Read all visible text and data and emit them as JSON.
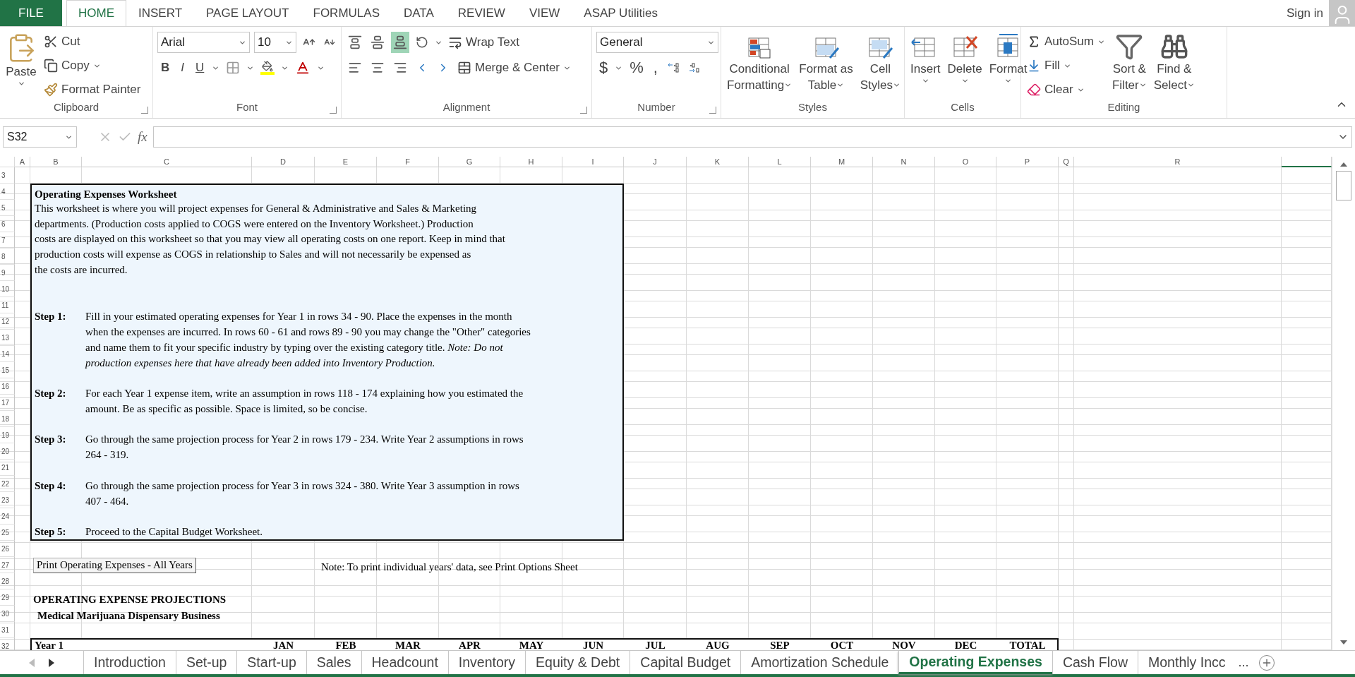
{
  "menu_tabs": [
    {
      "label": "FILE",
      "kind": "file",
      "selected": false
    },
    {
      "label": "HOME",
      "kind": "tab",
      "selected": true
    },
    {
      "label": "INSERT",
      "kind": "tab",
      "selected": false
    },
    {
      "label": "PAGE LAYOUT",
      "kind": "tab",
      "selected": false
    },
    {
      "label": "FORMULAS",
      "kind": "tab",
      "selected": false
    },
    {
      "label": "DATA",
      "kind": "tab",
      "selected": false
    },
    {
      "label": "REVIEW",
      "kind": "tab",
      "selected": false
    },
    {
      "label": "VIEW",
      "kind": "tab",
      "selected": false
    },
    {
      "label": "ASAP Utilities",
      "kind": "tab",
      "selected": false
    }
  ],
  "account": {
    "label": "Sign in"
  },
  "ribbon": {
    "groups": [
      {
        "kind": "clipboard",
        "label": "Clipboard",
        "launcher": true,
        "paste": "Paste",
        "items": [
          "Cut",
          "Copy",
          "Format Painter"
        ]
      },
      {
        "kind": "font",
        "label": "Font",
        "launcher": true,
        "font": "Arial",
        "size": "10",
        "styles": [
          "B",
          "I",
          "U"
        ]
      },
      {
        "kind": "alignment",
        "label": "Alignment",
        "launcher": true,
        "vertical_align": [
          {
            "selected": false
          },
          {
            "selected": false
          },
          {
            "selected": true
          }
        ],
        "wrap": "Wrap Text",
        "merge": "Merge & Center"
      },
      {
        "kind": "number",
        "label": "Number",
        "launcher": true,
        "format": "General",
        "symbols": [
          "$",
          "%",
          ","
        ]
      },
      {
        "kind": "styles",
        "label": "Styles",
        "buttons": [
          {
            "lines": [
              "Conditional",
              "Formatting"
            ]
          },
          {
            "lines": [
              "Format as",
              "Table"
            ]
          },
          {
            "lines": [
              "Cell",
              "Styles"
            ]
          }
        ]
      },
      {
        "kind": "cells",
        "label": "Cells",
        "buttons": [
          "Insert",
          "Delete",
          "Format"
        ]
      },
      {
        "kind": "editing",
        "label": "Editing",
        "small": [
          "AutoSum",
          "Fill",
          "Clear"
        ],
        "buttons": [
          {
            "lines": [
              "Sort &",
              "Filter"
            ]
          },
          {
            "lines": [
              "Find &",
              "Select"
            ]
          }
        ]
      }
    ]
  },
  "formula_bar": {
    "name_box": "S32",
    "fx": "fx"
  },
  "columns": [
    "A",
    "B",
    "C",
    "D",
    "E",
    "F",
    "G",
    "H",
    "I",
    "J",
    "K",
    "L",
    "M",
    "N",
    "O",
    "P",
    "Q",
    "R"
  ],
  "rows": [
    "3",
    "4",
    "5",
    "6",
    "7",
    "8",
    "9",
    "10",
    "11",
    "12",
    "13",
    "14",
    "15",
    "16",
    "17",
    "18",
    "19",
    "20",
    "21",
    "22",
    "23",
    "24",
    "25",
    "26",
    "27",
    "28",
    "29",
    "30",
    "31",
    "32"
  ],
  "instructions": {
    "title": "Operating Expenses Worksheet",
    "paragraph": [
      "This worksheet is where you will project expenses for General & Administrative and Sales & Marketing",
      "departments.  (Production costs applied to COGS were entered on the Inventory Worksheet.)  Production",
      "costs are displayed on this worksheet so that you may view all operating costs on one report.  Keep in mind that",
      "production costs will expense as COGS in relationship to Sales and will not necessarily be expensed as",
      "the costs are incurred."
    ],
    "steps": [
      {
        "label": "Step 1:",
        "lines": [
          "Fill in your estimated operating expenses for Year 1 in rows 34 - 90. Place the expenses in the month",
          "when the expenses are incurred. In rows 60 - 61 and rows 89 - 90 you may change the \"Other\" categories",
          "and name them to fit your specific industry by typing over the existing category title. *Note:  Do not*",
          "*production expenses here that have already been added into Inventory Production.*"
        ]
      },
      {
        "label": "Step 2:",
        "lines": [
          "For each Year 1 expense item, write an assumption in rows 118 - 174 explaining how you estimated the",
          "amount. Be as specific as possible. Space is limited, so be concise."
        ]
      },
      {
        "label": "Step 3:",
        "lines": [
          "Go through the same projection process for Year 2 in rows 179 - 234. Write Year 2 assumptions in rows",
          "264 - 319."
        ]
      },
      {
        "label": "Step 4:",
        "lines": [
          "Go through the same projection process for Year 3 in rows 324 - 380. Write Year 3 assumption in rows",
          "407 - 464."
        ]
      },
      {
        "label": "Step 5:",
        "lines": [
          "Proceed to the Capital Budget Worksheet."
        ]
      }
    ]
  },
  "print_button": "Print Operating Expenses - All Years",
  "print_note": "Note:  To print individual years' data, see Print Options Sheet",
  "projection_title": "OPERATING EXPENSE PROJECTIONS",
  "business_name": "Medical Marijuana Dispensary Business",
  "header_row": {
    "year": "Year 1",
    "months": [
      "JAN",
      "FEB",
      "MAR",
      "APR",
      "MAY",
      "JUN",
      "JUL",
      "AUG",
      "SEP",
      "OCT",
      "NOV",
      "DEC",
      "TOTAL"
    ]
  },
  "sheet_tabs": [
    {
      "label": "Introduction",
      "selected": false
    },
    {
      "label": "Set-up",
      "selected": false
    },
    {
      "label": "Start-up",
      "selected": false
    },
    {
      "label": "Sales",
      "selected": false
    },
    {
      "label": "Headcount",
      "selected": false
    },
    {
      "label": "Inventory",
      "selected": false
    },
    {
      "label": "Equity & Debt",
      "selected": false
    },
    {
      "label": "Capital Budget",
      "selected": false
    },
    {
      "label": "Amortization Schedule",
      "selected": false
    },
    {
      "label": "Operating Expenses",
      "selected": true
    },
    {
      "label": "Cash Flow",
      "selected": false
    },
    {
      "label": "Monthly Incc",
      "selected": false
    }
  ],
  "sheet_overflow": "..."
}
